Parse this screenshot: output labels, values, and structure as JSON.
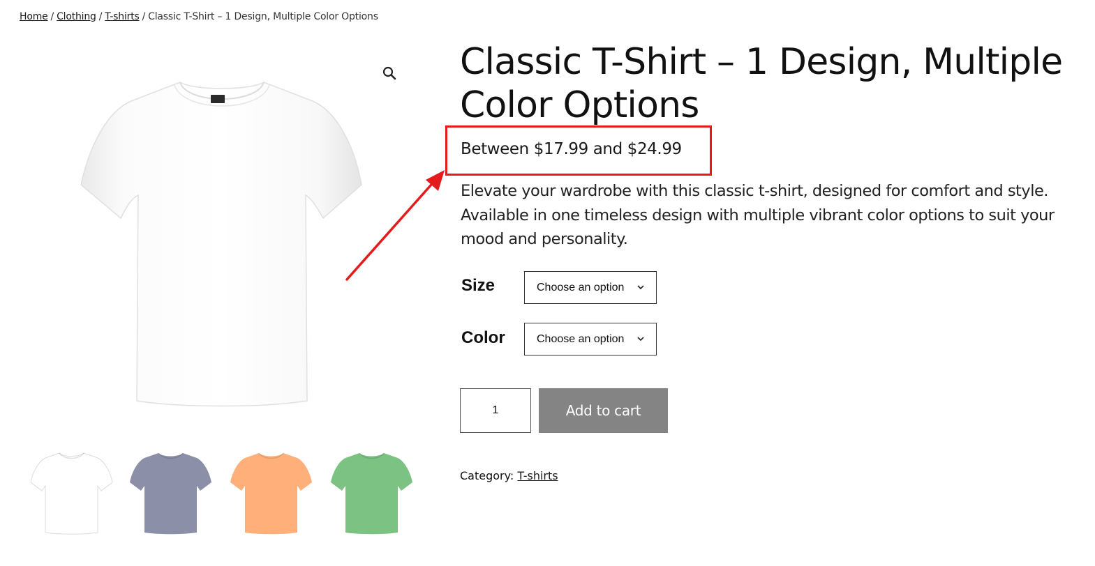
{
  "breadcrumb": {
    "items": [
      {
        "label": "Home",
        "link": true
      },
      {
        "label": "Clothing",
        "link": true
      },
      {
        "label": "T-shirts",
        "link": true
      },
      {
        "label": "Classic T-Shirt – 1 Design, Multiple Color Options",
        "link": false
      }
    ],
    "separator": "/"
  },
  "gallery": {
    "zoom_icon": "magnifier-icon",
    "main_color": "#ffffff",
    "thumbnail_colors": [
      "#ffffff",
      "#8c8fa8",
      "#ffb07a",
      "#7cc283"
    ]
  },
  "product": {
    "title": "Classic T-Shirt – 1 Design, Multiple Color Options",
    "price": "Between $17.99 and $24.99",
    "description": "Elevate your wardrobe with this classic t-shirt, designed for comfort and style. Available in one timeless design with multiple vibrant color options to suit your mood and personality.",
    "variations": [
      {
        "label": "Size",
        "selected": "Choose an option"
      },
      {
        "label": "Color",
        "selected": "Choose an option"
      }
    ],
    "quantity": "1",
    "add_to_cart_label": "Add to cart",
    "category_label": "Category:",
    "category_value": "T-shirts"
  },
  "annotation": {
    "highlight_color": "#e31b1b"
  }
}
